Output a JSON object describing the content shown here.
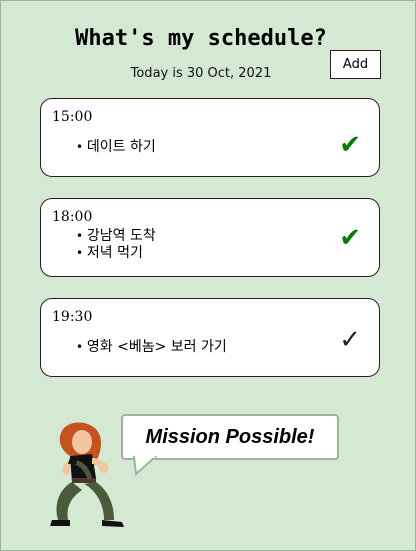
{
  "header": {
    "title": "What's my schedule?",
    "today": "Today is 30 Oct, 2021",
    "add_label": "Add"
  },
  "schedule": [
    {
      "time": "15:00",
      "tasks": [
        "데이트 하기"
      ],
      "done": true
    },
    {
      "time": "18:00",
      "tasks": [
        "강남역 도착",
        "저녁 먹기"
      ],
      "done": true
    },
    {
      "time": "19:30",
      "tasks": [
        "영화 <베놈> 보러 가기"
      ],
      "done": false
    }
  ],
  "mascot": {
    "speech": "Mission Possible!"
  },
  "colors": {
    "background": "#d5e8d4",
    "check_done": "#0a7a0a",
    "bubble_border": "#9fb39f"
  },
  "icons": {
    "check_done": "check-icon",
    "check_todo": "check-outline-icon"
  }
}
